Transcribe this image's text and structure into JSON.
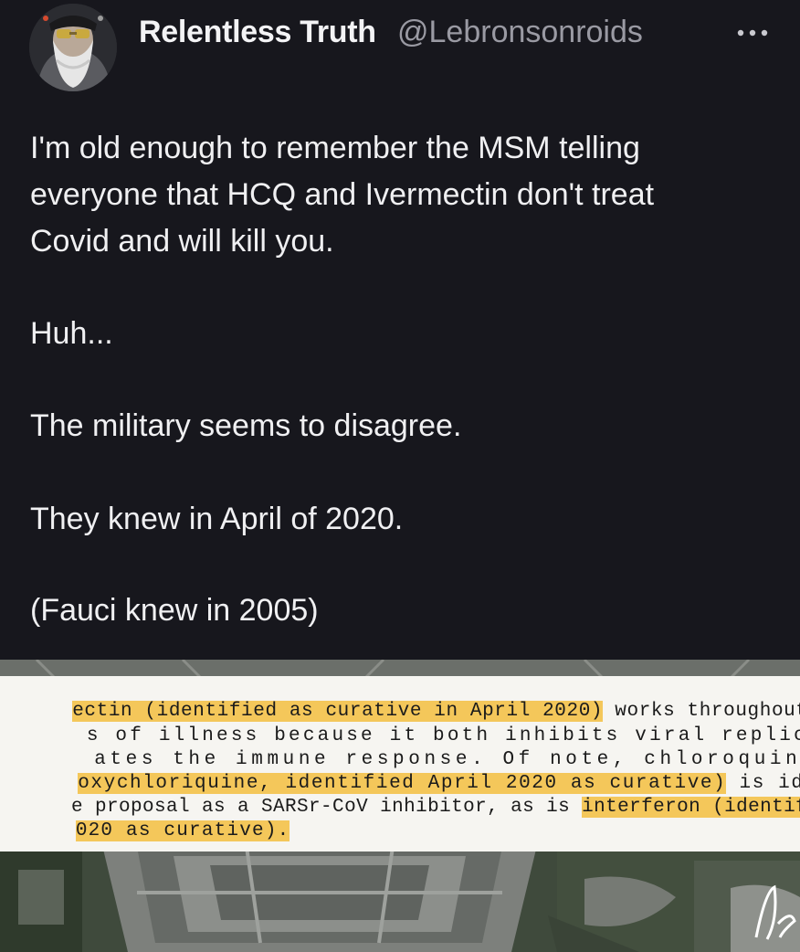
{
  "author": {
    "display_name": "Relentless Truth",
    "handle": "@Lebronsonroids",
    "avatar": "bearded-man-avatar"
  },
  "menu": {
    "more_icon": "more-horizontal-icon"
  },
  "tweet": {
    "paragraphs": [
      [
        "I'm old enough to remember the MSM telling",
        "everyone that HCQ and Ivermectin don't treat",
        "Covid and will kill you."
      ],
      [
        "Huh..."
      ],
      [
        "The military seems to disagree."
      ],
      [
        "They knew in April of 2020."
      ],
      [
        "(Fauci knew in 2005)"
      ]
    ]
  },
  "media": {
    "description": "aerial-pentagon-photo",
    "document_lines": [
      [
        {
          "t": "ectin (identified as curative in April 2020)",
          "h": true
        },
        {
          "t": " works throughout al",
          "h": false
        }
      ],
      [
        {
          "t": "s of illness because it both inhibits viral replication an",
          "h": false
        }
      ],
      [
        {
          "t": "ates the immune response. Of note, chloroquine phosphat",
          "h": false
        }
      ],
      [
        {
          "t": "oxychloriquine, identified April 2020 as curative)",
          "h": true
        },
        {
          "t": " is identifie",
          "h": false
        }
      ],
      [
        {
          "t": "e proposal as a SARSr-CoV inhibitor, as is ",
          "h": false
        },
        {
          "t": "interferon (identifie",
          "h": true
        }
      ],
      [
        {
          "t": "020 as curative).",
          "h": true
        }
      ]
    ],
    "colors": {
      "highlight": "#f4c75a",
      "paper": "#f6f5f1"
    }
  }
}
